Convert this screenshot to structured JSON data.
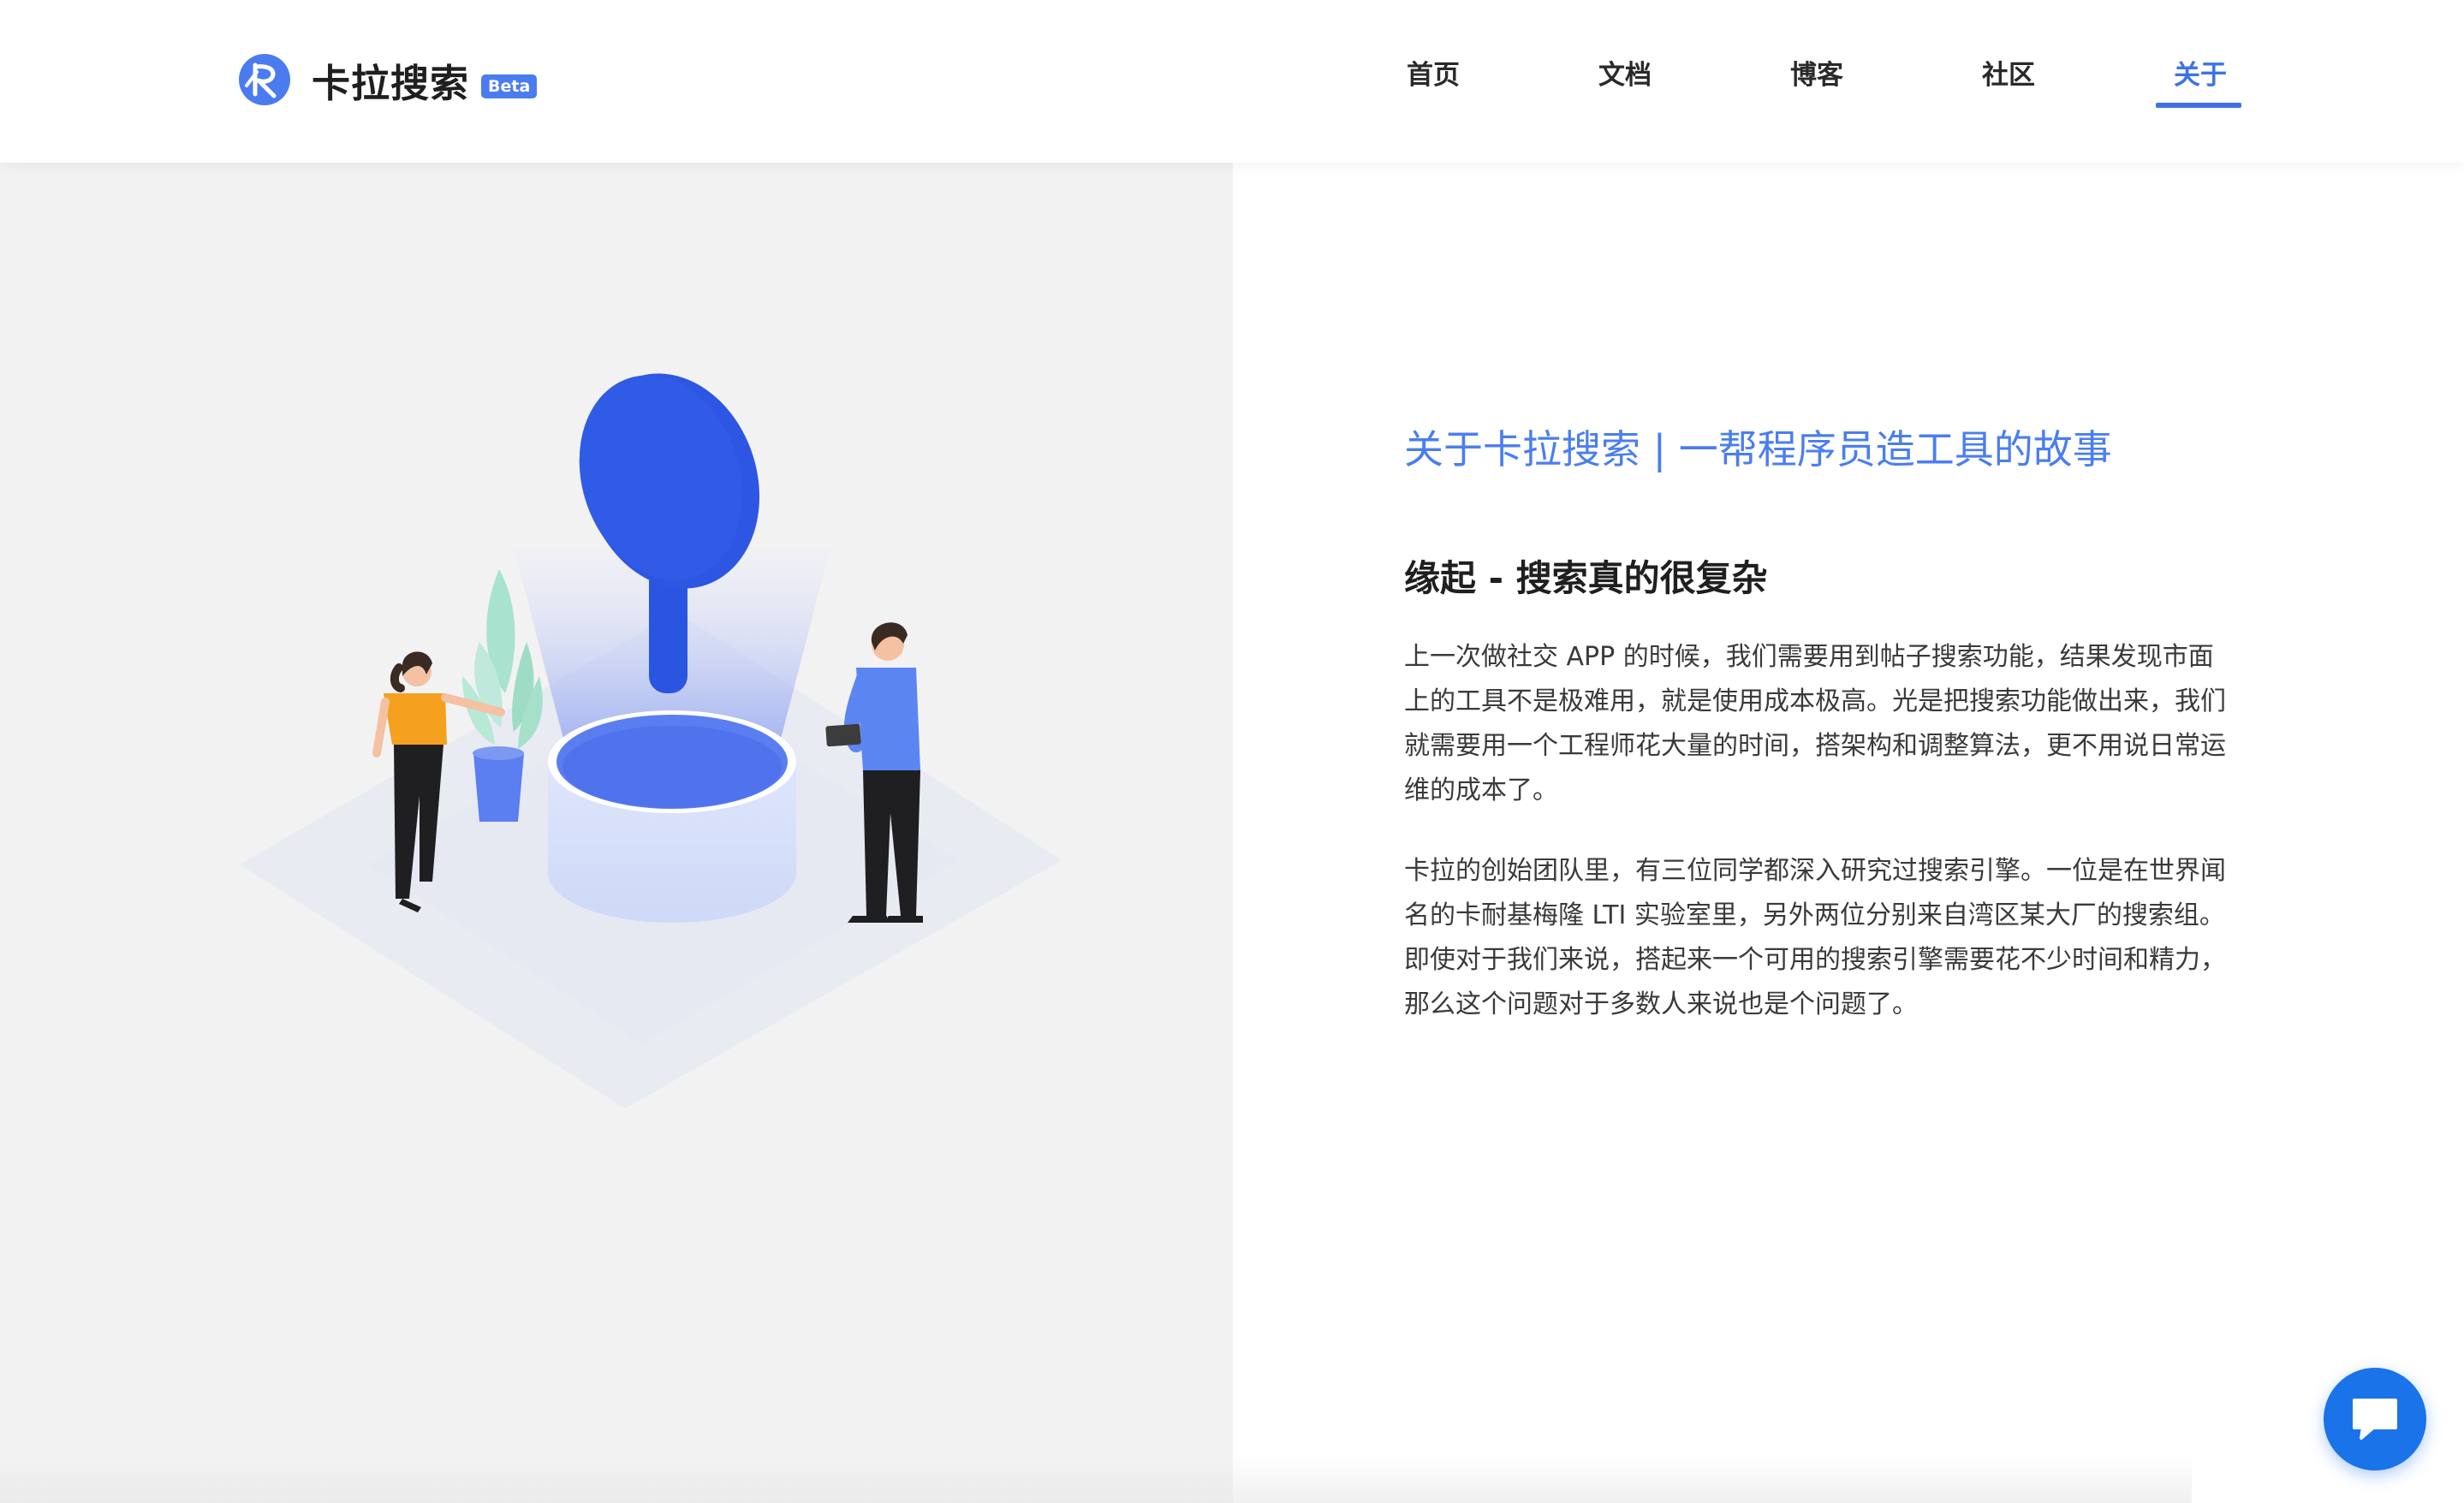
{
  "brand": {
    "name": "卡拉搜索",
    "badge": "Beta",
    "logo_icon": "kala-logo-icon"
  },
  "nav": {
    "items": [
      {
        "label": "首页"
      },
      {
        "label": "文档"
      },
      {
        "label": "博客"
      },
      {
        "label": "社区"
      },
      {
        "label": "关于",
        "active": true
      }
    ]
  },
  "hero": {
    "illustration": "search-team-illustration"
  },
  "about": {
    "title": "关于卡拉搜索 | 一帮程序员造工具的故事",
    "section_title": "缘起 - 搜索真的很复杂",
    "paragraphs": [
      "上一次做社交 APP 的时候，我们需要用到帖子搜索功能，结果发现市面上的工具不是极难用，就是使用成本极高。光是把搜索功能做出来，我们就需要用一个工程师花大量的时间，搭架构和调整算法，更不用说日常运维的成本了。",
      "卡拉的创始团队里，有三位同学都深入研究过搜索引擎。一位是在世界闻名的卡耐基梅隆 LTI 实验室里，另外两位分别来自湾区某大厂的搜索组。即使对于我们来说，搭起来一个可用的搜索引擎需要花不少时间和精力，那么这个问题对于多数人来说也是个问题了。"
    ]
  },
  "chat": {
    "icon": "chat-bubble-icon"
  },
  "colors": {
    "accent": "#3d72e8",
    "title_blue": "#4a7ef0",
    "chat_blue": "#1a73e8",
    "panel_gray": "#f2f2f3"
  }
}
